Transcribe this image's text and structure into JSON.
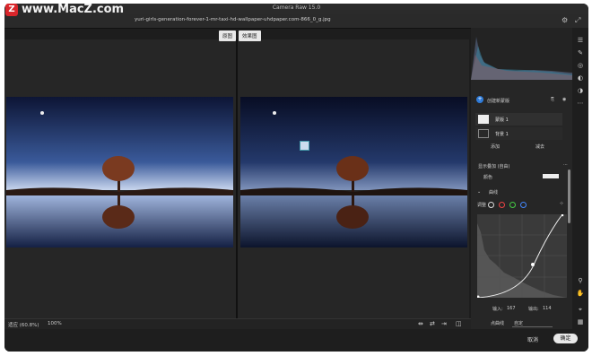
{
  "watermark": {
    "logo": "Z",
    "text": "www.MacZ.com"
  },
  "app": {
    "title": "Camera Raw 15.0"
  },
  "file": {
    "name": "yuri-girls-generation-forever-1-mr-taxi-hd-wallpaper-uhdpaper.com-866_0_g.jpg"
  },
  "view_tabs": [
    "原图",
    "效果图"
  ],
  "zoom": {
    "label": "适应 (60.8%)",
    "value": "100%"
  },
  "masks": {
    "create_label": "创建新蒙版",
    "mask_name": "蒙版 1",
    "layer_name": "背景 1",
    "add_label": "添加",
    "subtract_label": "减去"
  },
  "adjust": {
    "overlay_label": "显示叠加 (自由)",
    "color_label": "颜色",
    "curve_section": "曲线",
    "adjust_label": "调整",
    "input_label": "输入:",
    "input_value": "167",
    "output_label": "输出:",
    "output_value": "114",
    "point_curve_label": "点曲线",
    "point_curve_value": "自定"
  },
  "footer": {
    "cancel": "取消",
    "ok": "确定"
  }
}
